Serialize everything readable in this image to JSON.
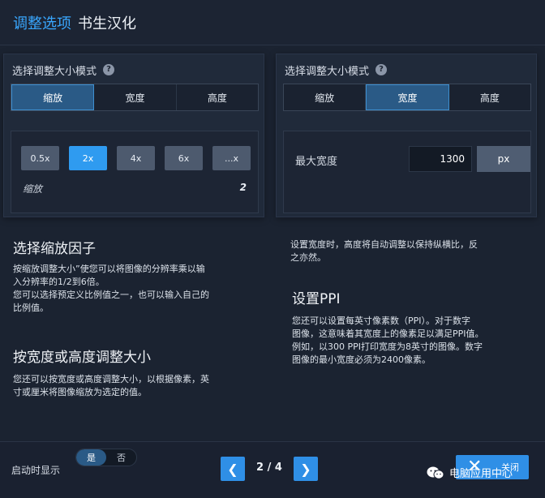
{
  "header": {
    "accent": "调整选项",
    "title": "书生汉化"
  },
  "left_panel": {
    "title": "选择调整大小模式",
    "tabs": [
      "缩放",
      "宽度",
      "高度"
    ],
    "active_tab": 0,
    "scales": [
      "0.5x",
      "2x",
      "4x",
      "6x",
      "...x"
    ],
    "active_scale": 1,
    "scale_label": "缩放",
    "scale_value": "2"
  },
  "right_panel": {
    "title": "选择调整大小模式",
    "tabs": [
      "缩放",
      "宽度",
      "高度"
    ],
    "active_tab": 1,
    "width_label": "最大宽度",
    "width_value": "1300",
    "unit": "px"
  },
  "help": {
    "scale_title": "选择缩放因子",
    "scale_text": [
      "按缩放调整大小”使您可以将图像的分辨率乘以输",
      "入分辨率的1/2到6倍。",
      "您可以选择预定义比例值之一，也可以输入自己的",
      "比例值。"
    ],
    "wh_title": "按宽度或高度调整大小",
    "wh_text": [
      "您还可以按宽度或高度调整大小，以根据像素，英",
      "寸或厘米将图像缩放为选定的值。"
    ],
    "width_text": [
      "设置宽度时，高度将自动调整以保持纵横比，反",
      "之亦然。"
    ],
    "ppi_title": "设置PPI",
    "ppi_text": [
      "您还可以设置每英寸像素数（PPI）。对于数字",
      "图像，这意味着其宽度上的像素足以满足PPI值。",
      "例如，以300 PPI打印宽度为8英寸的图像。数字",
      "图像的最小宽度必须为2400像素。"
    ]
  },
  "footer": {
    "startup_label": "启动时显示",
    "toggle_yes": "是",
    "toggle_no": "否",
    "page_indicator": "2 / 4",
    "prev_icon": "chevron-left-icon",
    "next_icon": "chevron-right-icon",
    "close_label": "关闭",
    "watermark": "电脑应用中心"
  }
}
